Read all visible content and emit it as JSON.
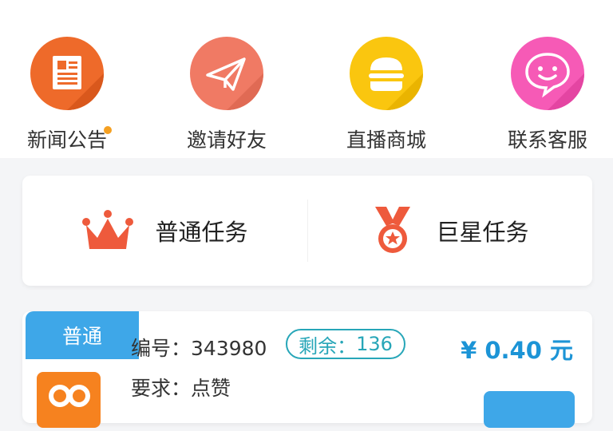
{
  "header": {
    "cut_text": ""
  },
  "nav": {
    "items": [
      {
        "label": "新闻公告",
        "icon": "newspaper-icon",
        "color": "#ee6a2a",
        "has_badge": true
      },
      {
        "label": "邀请好友",
        "icon": "paper-plane-icon",
        "color": "#f07a64"
      },
      {
        "label": "直播商城",
        "icon": "burger-icon",
        "color": "#fac60f"
      },
      {
        "label": "联系客服",
        "icon": "smile-chat-icon",
        "color": "#f65ab6"
      }
    ]
  },
  "tasks": {
    "normal_label": "普通任务",
    "star_label": "巨星任务",
    "icon_color": "#ee5a3c"
  },
  "job": {
    "type_tag": "普通",
    "id_label": "编号：",
    "id_value": "343980",
    "remain_label": "剩余：",
    "remain_value": "136",
    "req_label": "要求：",
    "req_value": "点赞",
    "price": "¥ 0.40 元",
    "grab_label": ""
  },
  "colors": {
    "accent": "#3ea7e8",
    "price": "#1c94d6",
    "pill": "#27a6b8"
  }
}
